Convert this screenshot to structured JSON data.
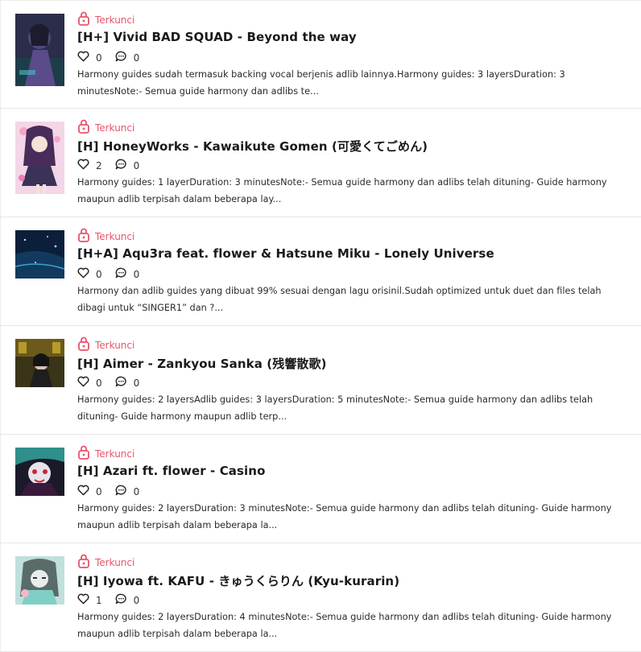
{
  "posts": [
    {
      "locked_label": "Terkunci",
      "title": "[H+] Vivid BAD SQUAD - Beyond the way",
      "likes": "0",
      "comments": "0",
      "excerpt": "Harmony guides sudah termasuk backing vocal berjenis adlib lainnya.Harmony guides: 3 layersDuration: 3 minutesNote:- Semua guide harmony dan adlibs te..."
    },
    {
      "locked_label": "Terkunci",
      "title": "[H] HoneyWorks - Kawaikute Gomen (可愛くてごめん)",
      "likes": "2",
      "comments": "0",
      "excerpt": "Harmony guides: 1 layerDuration: 3 minutesNote:- Semua guide harmony dan adlibs telah dituning- Guide harmony maupun adlib terpisah dalam beberapa lay..."
    },
    {
      "locked_label": "Terkunci",
      "title": "[H+A] Aqu3ra feat. flower & Hatsune Miku - Lonely Universe",
      "likes": "0",
      "comments": "0",
      "excerpt": "Harmony dan adlib guides yang dibuat 99% sesuai dengan lagu orisinil.Sudah optimized untuk duet dan files telah dibagi untuk “SINGER1” dan ?..."
    },
    {
      "locked_label": "Terkunci",
      "title": "[H] Aimer - Zankyou Sanka (残響散歌)",
      "likes": "0",
      "comments": "0",
      "excerpt": "Harmony guides: 2 layersAdlib guides: 3 layersDuration: 5 minutesNote:- Semua guide harmony dan adlibs telah dituning- Guide harmony maupun adlib terp..."
    },
    {
      "locked_label": "Terkunci",
      "title": "[H] Azari ft. flower - Casino",
      "likes": "0",
      "comments": "0",
      "excerpt": "Harmony guides: 2 layersDuration: 3 minutesNote:- Semua guide harmony dan adlibs telah dituning- Guide harmony maupun adlib terpisah dalam beberapa la..."
    },
    {
      "locked_label": "Terkunci",
      "title": "[H] Iyowa ft. KAFU - きゅうくらりん (Kyu-kurarin)",
      "likes": "1",
      "comments": "0",
      "excerpt": "Harmony guides: 2 layersDuration: 4 minutesNote:- Semua guide harmony dan adlibs telah dituning- Guide harmony maupun adlib terpisah dalam beberapa la..."
    }
  ],
  "colors": {
    "lock_accent": "#e8546a",
    "title_text": "#1a1a1a",
    "divider": "#e6e6e6"
  },
  "icons": {
    "lock": "lock-icon",
    "like": "heart-icon",
    "comment": "comment-icon"
  }
}
